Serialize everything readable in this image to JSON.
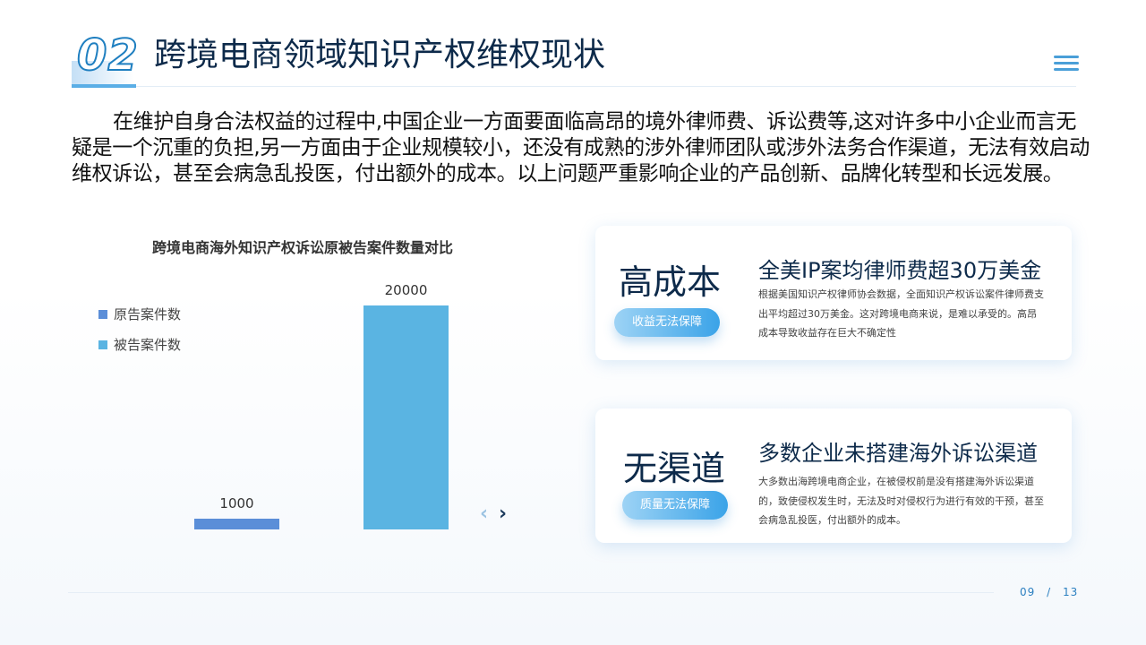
{
  "header": {
    "section_number": "02",
    "title": "跨境电商领域知识产权维权现状"
  },
  "intro_text": "在维护自身合法权益的过程中,中国企业一方面要面临高昂的境外律师费、诉讼费等,这对许多中小企业而言无疑是一个沉重的负担,另一方面由于企业规模较小，还没有成熟的涉外律师团队或涉外法务合作渠道，无法有效启动维权诉讼，甚至会病急乱投医，付出额外的成本。以上问题严重影响企业的产品创新、品牌化转型和长远发展。",
  "chart_data": {
    "type": "bar",
    "title": "跨境电商海外知识产权诉讼原被告案件数量对比",
    "series": [
      {
        "name": "原告案件数",
        "values": [
          1000
        ],
        "color": "#5b8ed8"
      },
      {
        "name": "被告案件数",
        "values": [
          20000
        ],
        "color": "#5ab4e2"
      }
    ],
    "data_labels": [
      "1000",
      "20000"
    ],
    "ylim": [
      0,
      20000
    ],
    "grid": false,
    "legend_position": "left"
  },
  "pager": {
    "prev": "‹",
    "next": "›"
  },
  "cards": [
    {
      "big_label": "高成本",
      "tag": "收益无法保障",
      "heading": "全美IP案均律师费超30万美金",
      "description": "根据美国知识产权律师协会数据，全面知识产权诉讼案件律师费支出平均超过30万美金。这对跨境电商来说，是难以承受的。高昂成本导致收益存在巨大不确定性"
    },
    {
      "big_label": "无渠道",
      "tag": "质量无法保障",
      "heading": "多数企业未搭建海外诉讼渠道",
      "description": "大多数出海跨境电商企业，在被侵权前是没有搭建海外诉讼渠道的，致使侵权发生时，无法及时对侵权行为进行有效的干预，甚至会病急乱投医，付出额外的成本。"
    }
  ],
  "footer": {
    "current_page": "09",
    "separator": "/",
    "total_pages": "13"
  },
  "colors": {
    "accent": "#2b7fc0",
    "title_dark": "#0d2a4a"
  }
}
